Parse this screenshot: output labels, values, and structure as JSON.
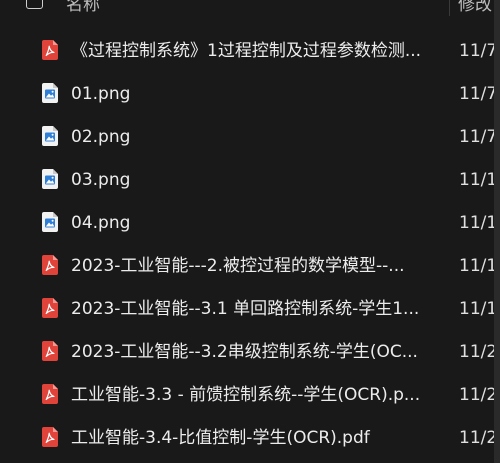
{
  "header": {
    "name_label": "名称",
    "date_label": "修改"
  },
  "files": [
    {
      "name": "《过程控制系统》1过程控制及过程参数检测...",
      "type": "pdf",
      "date": "11/7,"
    },
    {
      "name": "01.png",
      "type": "png",
      "date": "11/7,"
    },
    {
      "name": "02.png",
      "type": "png",
      "date": "11/7,"
    },
    {
      "name": "03.png",
      "type": "png",
      "date": "11/1"
    },
    {
      "name": "04.png",
      "type": "png",
      "date": "11/1-"
    },
    {
      "name": "2023-工业智能---2.被控过程的数学模型--...",
      "type": "pdf",
      "date": "11/1"
    },
    {
      "name": "2023-工业智能--3.1 单回路控制系统-学生1...",
      "type": "pdf",
      "date": "11/1-"
    },
    {
      "name": "2023-工业智能--3.2串级控制系统-学生(OC...",
      "type": "pdf",
      "date": "11/2"
    },
    {
      "name": "工业智能-3.3 - 前馈控制系统--学生(OCR).p...",
      "type": "pdf",
      "date": "11/2"
    },
    {
      "name": "工业智能-3.4-比值控制-学生(OCR).pdf",
      "type": "pdf",
      "date": "11/2"
    }
  ],
  "icons": {
    "pdf": "pdf-file-icon",
    "png": "image-file-icon"
  },
  "colors": {
    "background": "#191919",
    "pdf_icon": "#e0433a",
    "png_icon": "#2f7fd6"
  }
}
